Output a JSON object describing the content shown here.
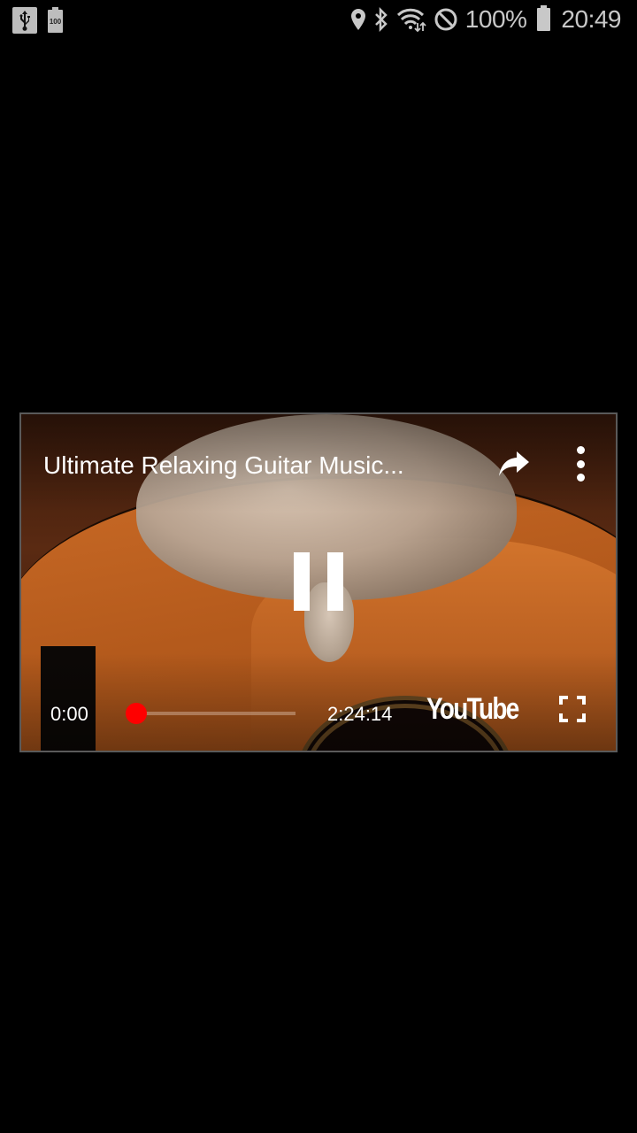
{
  "status_bar": {
    "left_icons": [
      "usb-icon",
      "battery-100-icon"
    ],
    "battery_small_label": "100",
    "right_icons": [
      "location-icon",
      "bluetooth-icon",
      "wifi-icon",
      "do-not-disturb-icon"
    ],
    "battery_percent": "100%",
    "time": "20:49"
  },
  "player": {
    "title": "Ultimate Relaxing Guitar Music...",
    "share_icon": "share-icon",
    "more_icon": "more-vert-icon",
    "state": "playing",
    "control_icon": "pause-icon",
    "current_time": "0:00",
    "total_time": "2:24:14",
    "progress": 0,
    "brand": "YouTube",
    "fullscreen_icon": "fullscreen-icon",
    "accent_color": "#ff0000"
  }
}
